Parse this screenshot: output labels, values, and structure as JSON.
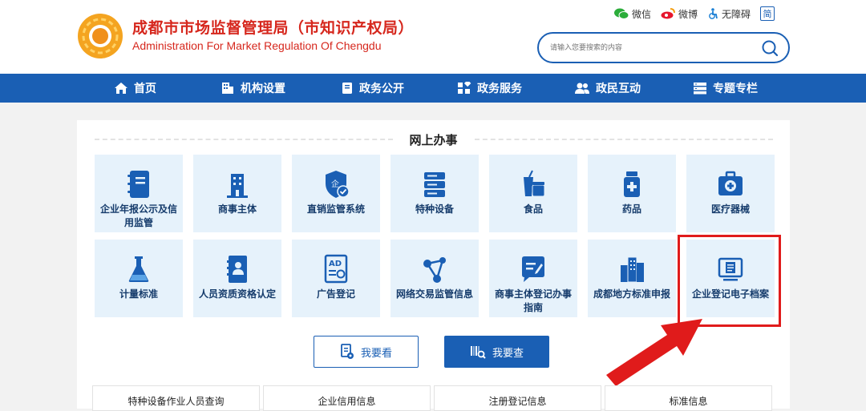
{
  "header": {
    "title_cn": "成都市市场监督管理局（市知识产权局）",
    "title_en": "Administration For Market Regulation Of Chengdu",
    "links": [
      {
        "label": "微信",
        "icon": "wechat-icon"
      },
      {
        "label": "微博",
        "icon": "weibo-icon"
      },
      {
        "label": "无障碍",
        "icon": "accessibility-icon"
      }
    ],
    "jian_label": "简",
    "search_placeholder": "请输入您要搜索的内容"
  },
  "nav": {
    "items": [
      {
        "label": "首页",
        "icon": "home-icon"
      },
      {
        "label": "机构设置",
        "icon": "building-icon"
      },
      {
        "label": "政务公开",
        "icon": "book-icon"
      },
      {
        "label": "政务服务",
        "icon": "grid-icon"
      },
      {
        "label": "政民互动",
        "icon": "people-icon"
      },
      {
        "label": "专题专栏",
        "icon": "list-icon"
      }
    ]
  },
  "main": {
    "section_title": "网上办事",
    "tiles": [
      {
        "label": "企业年报公示及信用监管",
        "icon": "notebook-icon"
      },
      {
        "label": "商事主体",
        "icon": "office-building-icon"
      },
      {
        "label": "直销监管系统",
        "icon": "shield-check-icon"
      },
      {
        "label": "特种设备",
        "icon": "server-icon"
      },
      {
        "label": "食品",
        "icon": "food-drink-icon"
      },
      {
        "label": "药品",
        "icon": "medicine-bottle-icon"
      },
      {
        "label": "医疗器械",
        "icon": "medical-kit-icon"
      },
      {
        "label": "计量标准",
        "icon": "flask-icon"
      },
      {
        "label": "人员资质资格认定",
        "icon": "contact-book-icon"
      },
      {
        "label": "广告登记",
        "icon": "ad-icon"
      },
      {
        "label": "网络交易监管信息",
        "icon": "network-nodes-icon"
      },
      {
        "label": "商事主体登记办事指南",
        "icon": "message-edit-icon"
      },
      {
        "label": "成都地方标准申报",
        "icon": "city-buildings-icon"
      },
      {
        "label": "企业登记电子档案",
        "icon": "monitor-document-icon"
      }
    ],
    "buttons": {
      "look": "我要看",
      "check": "我要查"
    },
    "query_tabs": [
      "特种设备作业人员查询",
      "企业信用信息",
      "注册登记信息",
      "标准信息"
    ]
  },
  "colors": {
    "brand_blue": "#1a5fb4",
    "title_red": "#d6271d",
    "tile_bg": "#e6f2fb",
    "highlight_red": "#e01b1b"
  }
}
